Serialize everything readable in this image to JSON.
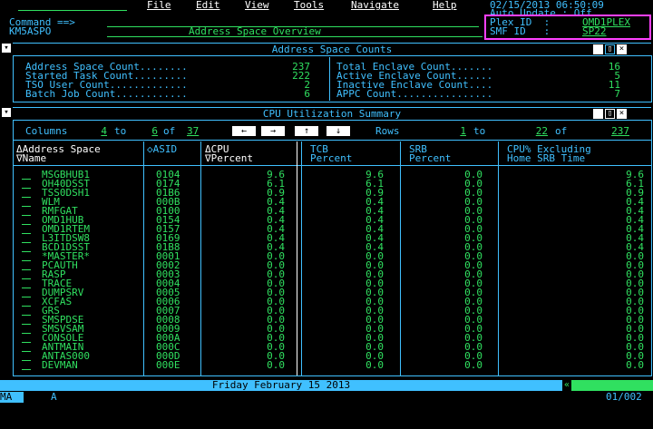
{
  "menubar": {
    "items": [
      "File",
      "Edit",
      "View",
      "Tools",
      "Navigate",
      "Help"
    ],
    "datetime": "02/15/2013 06:50:09",
    "auto_update": "Auto Update : Off"
  },
  "command": {
    "label": "Command ==>",
    "value": "",
    "workspace_id": "KM5ASPO",
    "workspace_title": "Address Space Overview"
  },
  "system": {
    "plex_label": "Plex ID  :",
    "plex_value": "OMD1PLEX",
    "smf_label": "SMF ID   :",
    "smf_value": "SP22"
  },
  "counts_panel": {
    "title": "Address Space Counts",
    "left": [
      {
        "label": "Address Space Count........",
        "value": "237"
      },
      {
        "label": "Started Task Count.........",
        "value": "222"
      },
      {
        "label": "TSO User Count.............",
        "value": "2"
      },
      {
        "label": "Batch Job Count............",
        "value": "6"
      }
    ],
    "right": [
      {
        "label": "Total Enclave Count.......",
        "value": "16"
      },
      {
        "label": "Active Enclave Count......",
        "value": "5"
      },
      {
        "label": "Inactive Enclave Count....",
        "value": "11"
      },
      {
        "label": "APPC Count................",
        "value": "7"
      }
    ]
  },
  "cpu_panel": {
    "title": "CPU Utilization Summary",
    "columns_label": "Columns",
    "col_from": "4",
    "col_to_word": "to",
    "col_to": "6",
    "col_of_word": "of",
    "col_total": "37",
    "rows_label": "Rows",
    "row_from": "1",
    "row_to_word": "to",
    "row_to": "22",
    "row_of_word": "of",
    "row_total": "237",
    "headers": {
      "name_1": "ΔAddress Space",
      "name_2": "∇Name",
      "asid": "◇ASID",
      "cpu_1": "ΔCPU",
      "cpu_2": "∇Percent",
      "tcb_1": "TCB",
      "tcb_2": "Percent",
      "srb_1": "SRB",
      "srb_2": "Percent",
      "excl_1": "CPU% Excluding",
      "excl_2": "Home SRB Time"
    },
    "rows": [
      [
        "MSGBHUB1",
        "0104",
        "9.6",
        "9.6",
        "0.0",
        "9.6"
      ],
      [
        "OH40DSST",
        "0174",
        "6.1",
        "6.1",
        "0.0",
        "6.1"
      ],
      [
        "TSS0DSH1",
        "01B6",
        "0.9",
        "0.9",
        "0.0",
        "0.9"
      ],
      [
        "WLM",
        "000B",
        "0.4",
        "0.4",
        "0.0",
        "0.4"
      ],
      [
        "RMFGAT",
        "0100",
        "0.4",
        "0.4",
        "0.0",
        "0.4"
      ],
      [
        "OMD1HUB",
        "0154",
        "0.4",
        "0.4",
        "0.0",
        "0.4"
      ],
      [
        "OMD1RTEM",
        "0157",
        "0.4",
        "0.4",
        "0.0",
        "0.4"
      ],
      [
        "L3ITDSW8",
        "0169",
        "0.4",
        "0.4",
        "0.0",
        "0.4"
      ],
      [
        "BCD1DSST",
        "01B8",
        "0.4",
        "0.4",
        "0.0",
        "0.4"
      ],
      [
        "*MASTER*",
        "0001",
        "0.0",
        "0.0",
        "0.0",
        "0.0"
      ],
      [
        "PCAUTH",
        "0002",
        "0.0",
        "0.0",
        "0.0",
        "0.0"
      ],
      [
        "RASP",
        "0003",
        "0.0",
        "0.0",
        "0.0",
        "0.0"
      ],
      [
        "TRACE",
        "0004",
        "0.0",
        "0.0",
        "0.0",
        "0.0"
      ],
      [
        "DUMPSRV",
        "0005",
        "0.0",
        "0.0",
        "0.0",
        "0.0"
      ],
      [
        "XCFAS",
        "0006",
        "0.0",
        "0.0",
        "0.0",
        "0.0"
      ],
      [
        "GRS",
        "0007",
        "0.0",
        "0.0",
        "0.0",
        "0.0"
      ],
      [
        "SMSPDSE",
        "0008",
        "0.0",
        "0.0",
        "0.0",
        "0.0"
      ],
      [
        "SMSVSAM",
        "0009",
        "0.0",
        "0.0",
        "0.0",
        "0.0"
      ],
      [
        "CONSOLE",
        "000A",
        "0.0",
        "0.0",
        "0.0",
        "0.0"
      ],
      [
        "ANTMAIN",
        "000C",
        "0.0",
        "0.0",
        "0.0",
        "0.0"
      ],
      [
        "ANTAS000",
        "000D",
        "0.0",
        "0.0",
        "0.0",
        "0.0"
      ],
      [
        "DEVMAN",
        "000E",
        "0.0",
        "0.0",
        "0.0",
        "0.0"
      ]
    ]
  },
  "status": {
    "date_banner": "Friday February 15 2013",
    "bottom_left": "MA",
    "bottom_a": "A",
    "bottom_right": "01/002"
  },
  "colors": {
    "green": "#30e060",
    "cyan": "#40c0ff",
    "pink": "#ff60ff",
    "white": "#ffffff"
  }
}
